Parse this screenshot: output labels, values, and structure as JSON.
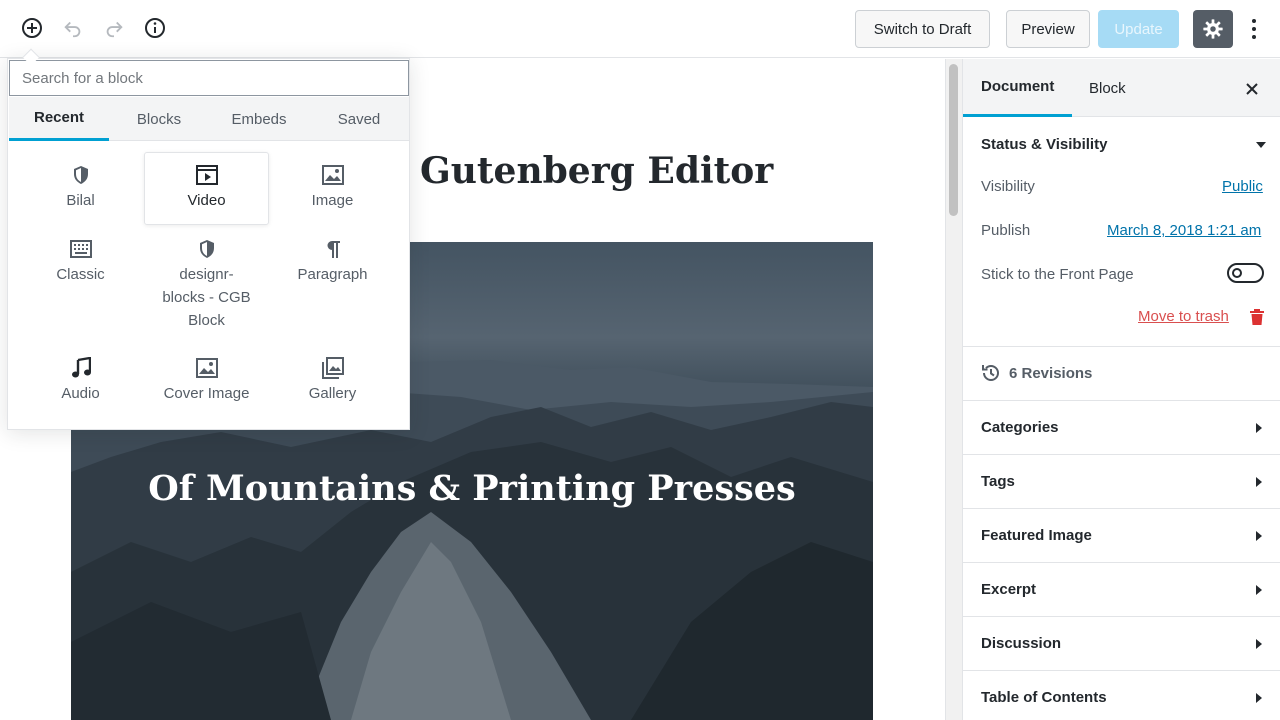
{
  "toolbar": {
    "switch_to_draft": "Switch to Draft",
    "preview": "Preview",
    "update": "Update"
  },
  "inserter": {
    "search_placeholder": "Search for a block",
    "tabs": [
      "Recent",
      "Blocks",
      "Embeds",
      "Saved"
    ],
    "active_tab": "Recent",
    "blocks": [
      {
        "label": "Bilal",
        "icon": "shield-icon"
      },
      {
        "label": "Video",
        "icon": "video-icon"
      },
      {
        "label": "Image",
        "icon": "image-icon"
      },
      {
        "label": "Classic",
        "icon": "keyboard-icon"
      },
      {
        "label": "designr-blocks - CGB Block",
        "icon": "shield-icon"
      },
      {
        "label": "Paragraph",
        "icon": "paragraph-icon"
      },
      {
        "label": "Audio",
        "icon": "music-note-icon"
      },
      {
        "label": "Cover Image",
        "icon": "cover-image-icon"
      },
      {
        "label": "Gallery",
        "icon": "gallery-icon"
      }
    ],
    "block_labels": {
      "b0": "Bilal",
      "b1": "Video",
      "b2": "Image",
      "b3": "Classic",
      "b4a": "designr-",
      "b4b": "blocks - CGB",
      "b4c": "Block",
      "b5": "Paragraph",
      "b6": "Audio",
      "b7": "Cover Image",
      "b8": "Gallery"
    }
  },
  "editor": {
    "post_title": "Gutenberg Editor",
    "cover_title": "Of Mountains & Printing Presses"
  },
  "sidebar": {
    "tabs": {
      "document": "Document",
      "block": "Block"
    },
    "active_tab": "Document",
    "status_visibility": {
      "title": "Status & Visibility",
      "visibility_label": "Visibility",
      "visibility_value": "Public",
      "publish_label": "Publish",
      "publish_value": "March 8, 2018 1:21 am",
      "sticky_label": "Stick to the Front Page",
      "sticky_on": false,
      "trash": "Move to trash"
    },
    "revisions": "6 Revisions",
    "panels": [
      "Categories",
      "Tags",
      "Featured Image",
      "Excerpt",
      "Discussion",
      "Table of Contents"
    ]
  },
  "colors": {
    "accent": "#00a0d2",
    "link": "#0073aa",
    "trash": "#d94f4f",
    "update_disabled": "#a6dbf5",
    "settings_active": "#555d66"
  }
}
